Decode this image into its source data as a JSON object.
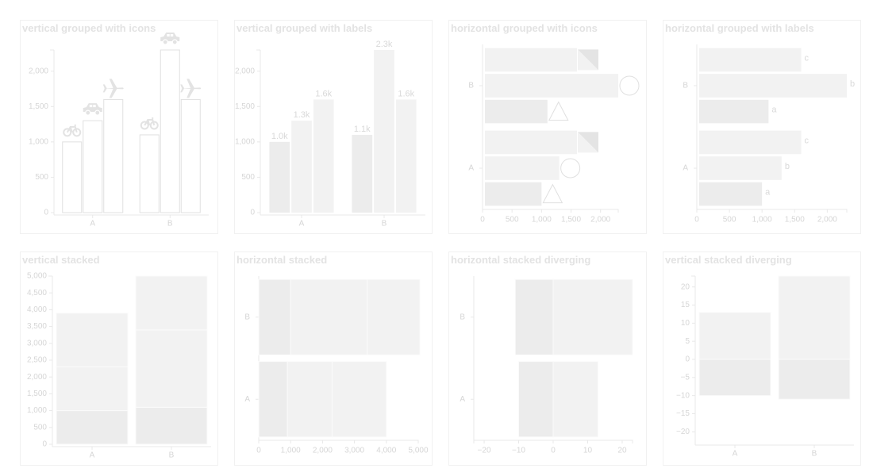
{
  "colors": {
    "title": "#e3e3e3",
    "axis": "#e8e8e8",
    "tick_text": "#d6d6d6",
    "bar_fill": "#f2f2f2",
    "bar_fill_dark": "#ececec",
    "bar_stroke": "#e0e0e0",
    "bar_divider": "#fbfbfb",
    "icon": "#e3e3e3",
    "label": "#d9d9d9"
  },
  "chart_data": [
    {
      "id": "c1",
      "type": "bar",
      "orientation": "vertical",
      "style": "icons",
      "title": "vertical grouped with icons",
      "categories": [
        "A",
        "B"
      ],
      "series": [
        {
          "icon": "bicycle-icon",
          "values": [
            1000,
            1100
          ]
        },
        {
          "icon": "car-icon",
          "values": [
            1300,
            2300
          ]
        },
        {
          "icon": "airplane-icon",
          "values": [
            1600,
            1600
          ]
        }
      ],
      "ylim": [
        0,
        2300
      ],
      "ticks": [
        0,
        500,
        1000,
        1500,
        2000
      ],
      "tick_labels": [
        "0",
        "500",
        "1,000",
        "1,500",
        "2,000"
      ]
    },
    {
      "id": "c2",
      "type": "bar",
      "orientation": "vertical",
      "style": "labels",
      "title": "vertical grouped with labels",
      "categories": [
        "A",
        "B"
      ],
      "series": [
        {
          "values": [
            1000,
            1100
          ],
          "labels": [
            "1.0k",
            "1.1k"
          ]
        },
        {
          "values": [
            1300,
            2300
          ],
          "labels": [
            "1.3k",
            "2.3k"
          ]
        },
        {
          "values": [
            1600,
            1600
          ],
          "labels": [
            "1.6k",
            "1.6k"
          ]
        }
      ],
      "ylim": [
        0,
        2300
      ],
      "ticks": [
        0,
        500,
        1000,
        1500,
        2000
      ],
      "tick_labels": [
        "0",
        "500",
        "1,000",
        "1,500",
        "2,000"
      ]
    },
    {
      "id": "c3",
      "type": "bar",
      "orientation": "horizontal",
      "style": "icons",
      "title": "horizontal grouped with icons",
      "categories": [
        "A",
        "B"
      ],
      "series": [
        {
          "icon": "triangle-icon",
          "values": [
            1000,
            1100
          ]
        },
        {
          "icon": "circle-icon",
          "values": [
            1300,
            2300
          ]
        },
        {
          "icon": "corner-triangle-icon",
          "values": [
            1600,
            1600
          ]
        }
      ],
      "xlim": [
        0,
        2300
      ],
      "ticks": [
        0,
        500,
        1000,
        1500,
        2000
      ],
      "tick_labels": [
        "0",
        "500",
        "1,000",
        "1,500",
        "2,000"
      ]
    },
    {
      "id": "c4",
      "type": "bar",
      "orientation": "horizontal",
      "style": "labels",
      "title": "horizontal grouped with labels",
      "categories": [
        "A",
        "B"
      ],
      "series": [
        {
          "values": [
            1000,
            1100
          ],
          "labels": [
            "a",
            "a"
          ]
        },
        {
          "values": [
            1300,
            2300
          ],
          "labels": [
            "b",
            "b"
          ]
        },
        {
          "values": [
            1600,
            1600
          ],
          "labels": [
            "c",
            "c"
          ]
        }
      ],
      "xlim": [
        0,
        2300
      ],
      "ticks": [
        0,
        500,
        1000,
        1500,
        2000
      ],
      "tick_labels": [
        "0",
        "500",
        "1,000",
        "1,500",
        "2,000"
      ]
    },
    {
      "id": "c5",
      "type": "bar",
      "orientation": "vertical",
      "style": "stacked",
      "title": "vertical stacked",
      "categories": [
        "A",
        "B"
      ],
      "series": [
        {
          "values": [
            1000,
            1100
          ]
        },
        {
          "values": [
            1300,
            2300
          ]
        },
        {
          "values": [
            1600,
            1600
          ]
        }
      ],
      "ylim": [
        0,
        5000
      ],
      "ticks": [
        0,
        500,
        1000,
        1500,
        2000,
        2500,
        3000,
        3500,
        4000,
        4500,
        5000
      ],
      "tick_labels": [
        "0",
        "500",
        "1,000",
        "1,500",
        "2,000",
        "2,500",
        "3,000",
        "3,500",
        "4,000",
        "4,500",
        "5,000"
      ]
    },
    {
      "id": "c6",
      "type": "bar",
      "orientation": "horizontal",
      "style": "stacked",
      "title": "horizontal stacked",
      "categories": [
        "A",
        "B"
      ],
      "series": [
        {
          "values": [
            900,
            1000
          ]
        },
        {
          "values": [
            1400,
            2400
          ]
        },
        {
          "values": [
            1700,
            1650
          ]
        }
      ],
      "xlim": [
        0,
        5000
      ],
      "ticks": [
        0,
        1000,
        2000,
        3000,
        4000,
        5000
      ],
      "tick_labels": [
        "0",
        "1,000",
        "2,000",
        "3,000",
        "4,000",
        "5,000"
      ]
    },
    {
      "id": "c7",
      "type": "bar",
      "orientation": "horizontal",
      "style": "diverging",
      "title": "horizontal stacked diverging",
      "categories": [
        "A",
        "B"
      ],
      "series": [
        {
          "values": [
            -10,
            -11
          ]
        },
        {
          "values": [
            13,
            23
          ]
        }
      ],
      "xlim": [
        -23,
        23
      ],
      "ticks": [
        -20,
        -10,
        0,
        10,
        20
      ],
      "tick_labels": [
        "−20",
        "−10",
        "0",
        "10",
        "20"
      ]
    },
    {
      "id": "c8",
      "type": "bar",
      "orientation": "vertical",
      "style": "diverging",
      "title": "vertical stacked diverging",
      "categories": [
        "A",
        "B"
      ],
      "series": [
        {
          "values": [
            -10,
            -11
          ]
        },
        {
          "values": [
            13,
            23
          ]
        }
      ],
      "ylim": [
        -23,
        23
      ],
      "ticks": [
        -20,
        -15,
        -10,
        -5,
        0,
        5,
        10,
        15,
        20
      ],
      "tick_labels": [
        "−20",
        "−15",
        "−10",
        "−5",
        "0",
        "5",
        "10",
        "15",
        "20"
      ]
    }
  ]
}
